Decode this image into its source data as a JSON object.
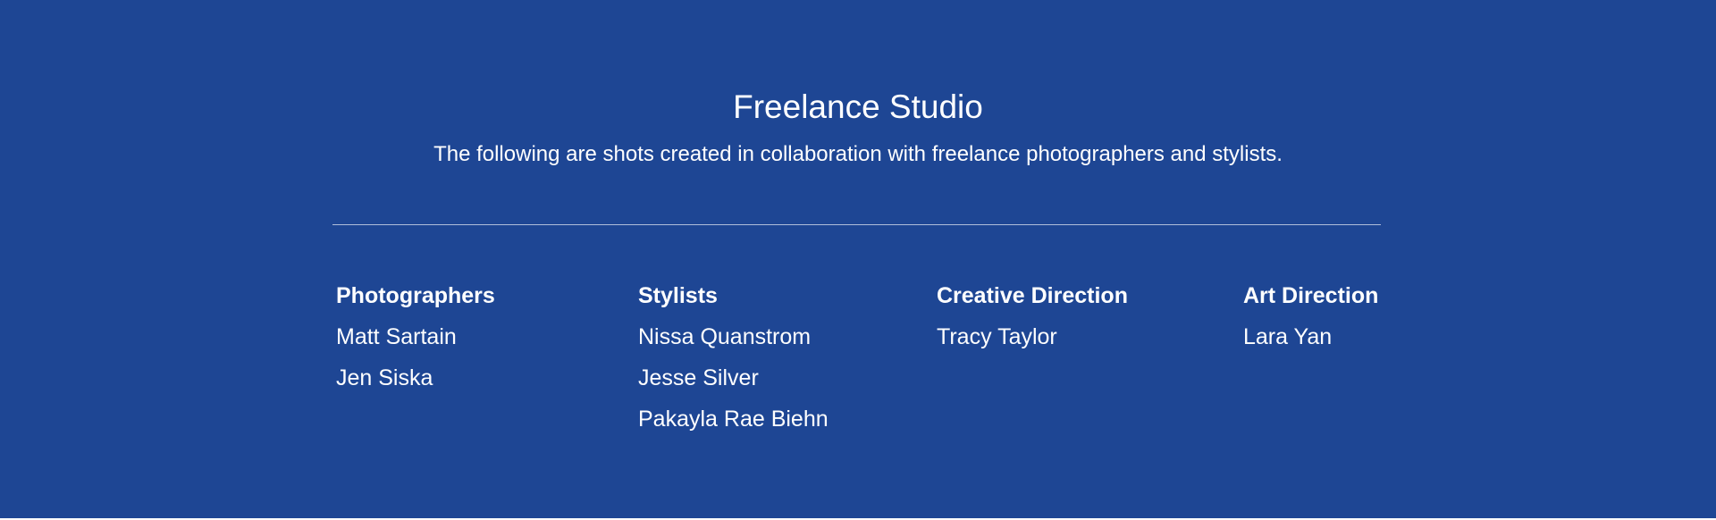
{
  "studio": {
    "title": "Freelance Studio",
    "subtitle": "The following are shots created in collaboration with freelance photographers and stylists."
  },
  "credits": [
    {
      "heading": "Photographers",
      "names": [
        "Matt Sartain",
        "Jen Siska"
      ]
    },
    {
      "heading": "Stylists",
      "names": [
        "Nissa Quanstrom",
        "Jesse Silver",
        "Pakayla Rae Biehn"
      ]
    },
    {
      "heading": "Creative Direction",
      "names": [
        "Tracy Taylor"
      ]
    },
    {
      "heading": "Art Direction",
      "names": [
        "Lara Yan"
      ]
    }
  ],
  "colors": {
    "background": "#1e4694",
    "text": "#ffffff"
  }
}
